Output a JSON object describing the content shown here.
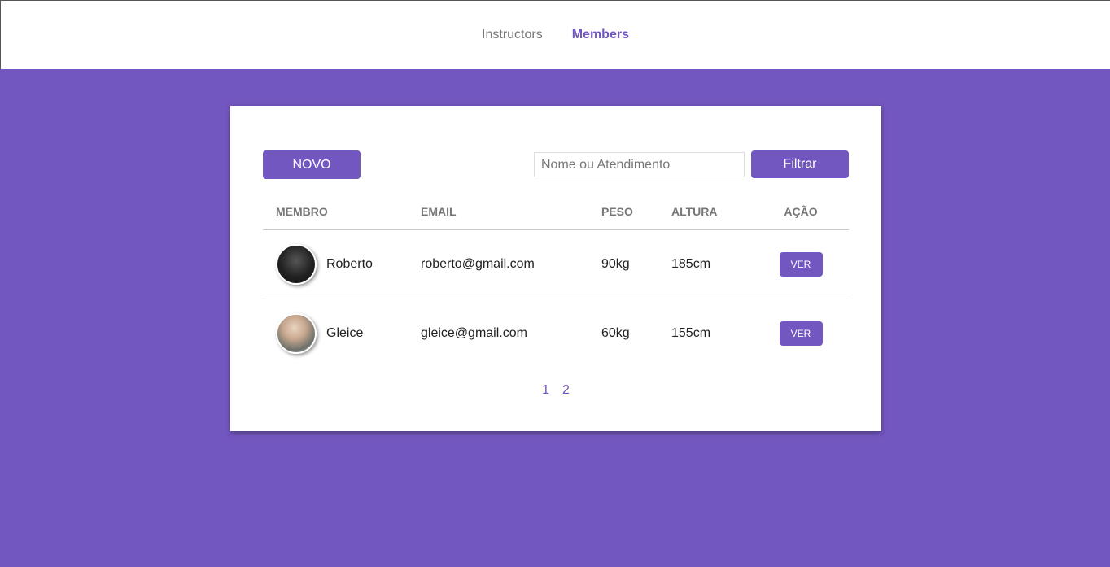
{
  "nav": {
    "items": [
      {
        "label": "Instructors",
        "active": false
      },
      {
        "label": "Members",
        "active": true
      }
    ]
  },
  "toolbar": {
    "new_label": "NOVO",
    "search_placeholder": "Nome ou Atendimento",
    "search_value": "",
    "filter_label": "Filtrar"
  },
  "table": {
    "headers": [
      "MEMBRO",
      "EMAIL",
      "PESO",
      "ALTURA",
      "AÇÃO"
    ],
    "rows": [
      {
        "name": "Roberto",
        "email": "roberto@gmail.com",
        "weight": "90kg",
        "height": "185cm",
        "action": "VER"
      },
      {
        "name": "Gleice",
        "email": "gleice@gmail.com",
        "weight": "60kg",
        "height": "155cm",
        "action": "VER"
      }
    ]
  },
  "pagination": {
    "pages": [
      "1",
      "2"
    ]
  },
  "colors": {
    "accent": "#7357c0",
    "background": "#7357c0",
    "card": "#ffffff"
  }
}
